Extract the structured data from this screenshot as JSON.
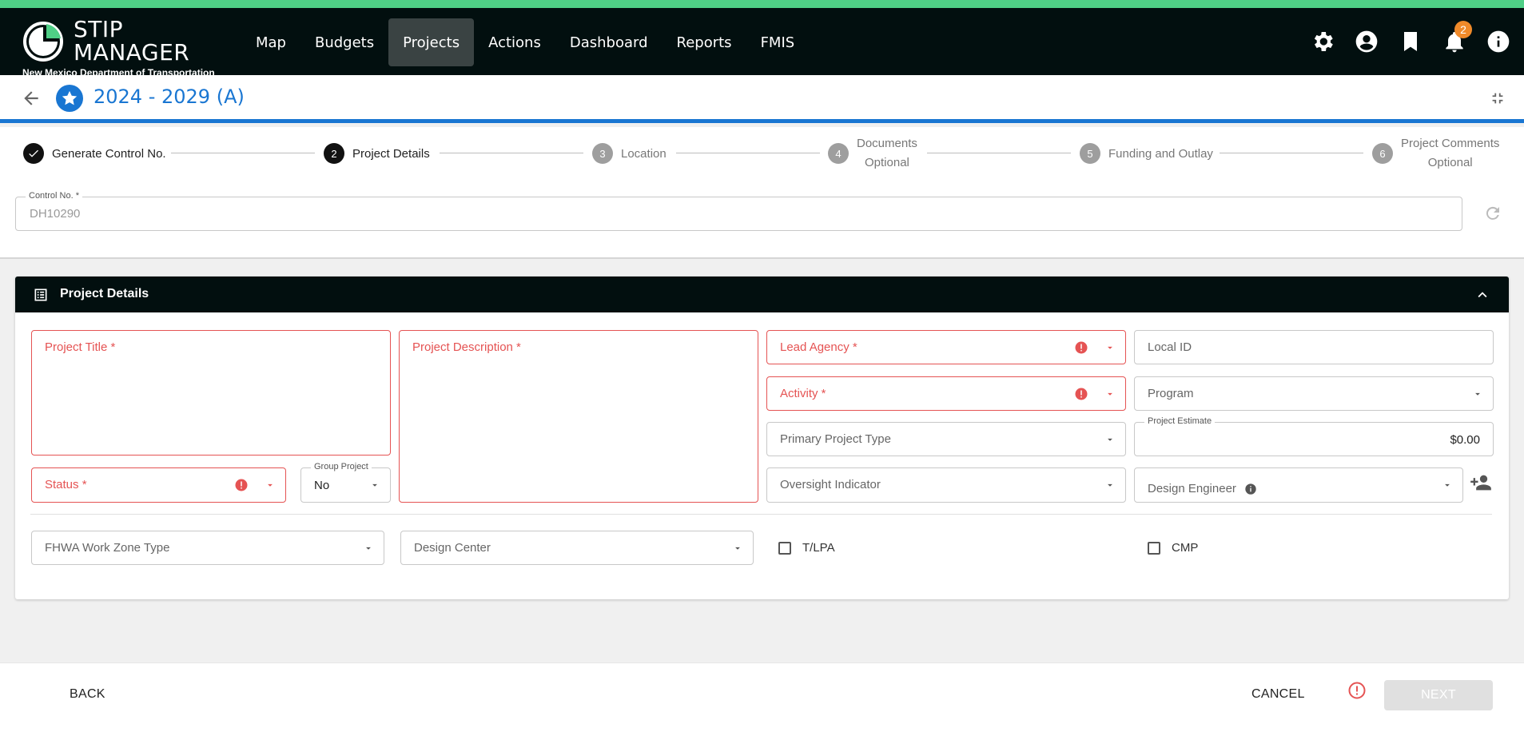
{
  "app": {
    "title": "STIP MANAGER",
    "title_line1": "STIP",
    "title_line2": "MANAGER",
    "subtitle": "New Mexico Department of Transportation"
  },
  "colors": {
    "accent": "#4fcf86",
    "primary": "#1976d2",
    "error": "#e55353",
    "header_bg": "#020f0f",
    "badge": "#f08a2a"
  },
  "nav": {
    "items": [
      {
        "label": "Map"
      },
      {
        "label": "Budgets"
      },
      {
        "label": "Projects",
        "active": true
      },
      {
        "label": "Actions"
      },
      {
        "label": "Dashboard"
      },
      {
        "label": "Reports"
      },
      {
        "label": "FMIS"
      }
    ]
  },
  "header_icons": [
    "settings-icon",
    "account-icon",
    "bookmark-icon",
    "bell-icon",
    "info-icon"
  ],
  "notifications": {
    "count": "2"
  },
  "page": {
    "title": "2024 - 2029 (A)"
  },
  "stepper": {
    "steps": [
      {
        "number": "",
        "label": "Generate Control No.",
        "status": "done"
      },
      {
        "number": "2",
        "label": "Project Details",
        "status": "current"
      },
      {
        "number": "3",
        "label": "Location",
        "status": "todo"
      },
      {
        "number": "4",
        "label": "Documents",
        "sub": "Optional",
        "status": "todo"
      },
      {
        "number": "5",
        "label": "Funding and Outlay",
        "status": "todo"
      },
      {
        "number": "6",
        "label": "Project Comments",
        "sub": "Optional",
        "status": "todo"
      }
    ]
  },
  "control_no": {
    "label": "Control No. *",
    "value": "DH10290"
  },
  "details": {
    "title": "Project Details",
    "project_title": {
      "label": "Project Title *"
    },
    "project_description": {
      "label": "Project Description *"
    },
    "status": {
      "label": "Status *"
    },
    "group_project": {
      "label": "Group Project",
      "value": "No"
    },
    "lead_agency": {
      "label": "Lead Agency *"
    },
    "activity": {
      "label": "Activity *"
    },
    "primary_project_type": {
      "label": "Primary Project Type"
    },
    "oversight_indicator": {
      "label": "Oversight Indicator"
    },
    "local_id": {
      "label": "Local ID"
    },
    "program": {
      "label": "Program"
    },
    "project_estimate": {
      "label": "Project Estimate",
      "value": "$0.00"
    },
    "design_engineer": {
      "label": "Design Engineer"
    },
    "fhwa_work_zone_type": {
      "label": "FHWA Work Zone Type"
    },
    "design_center": {
      "label": "Design Center"
    },
    "tlpa": {
      "label": "T/LPA",
      "checked": false
    },
    "cmp": {
      "label": "CMP",
      "checked": false
    }
  },
  "footer": {
    "back_label": "BACK",
    "cancel_label": "CANCEL",
    "next_label": "NEXT"
  }
}
